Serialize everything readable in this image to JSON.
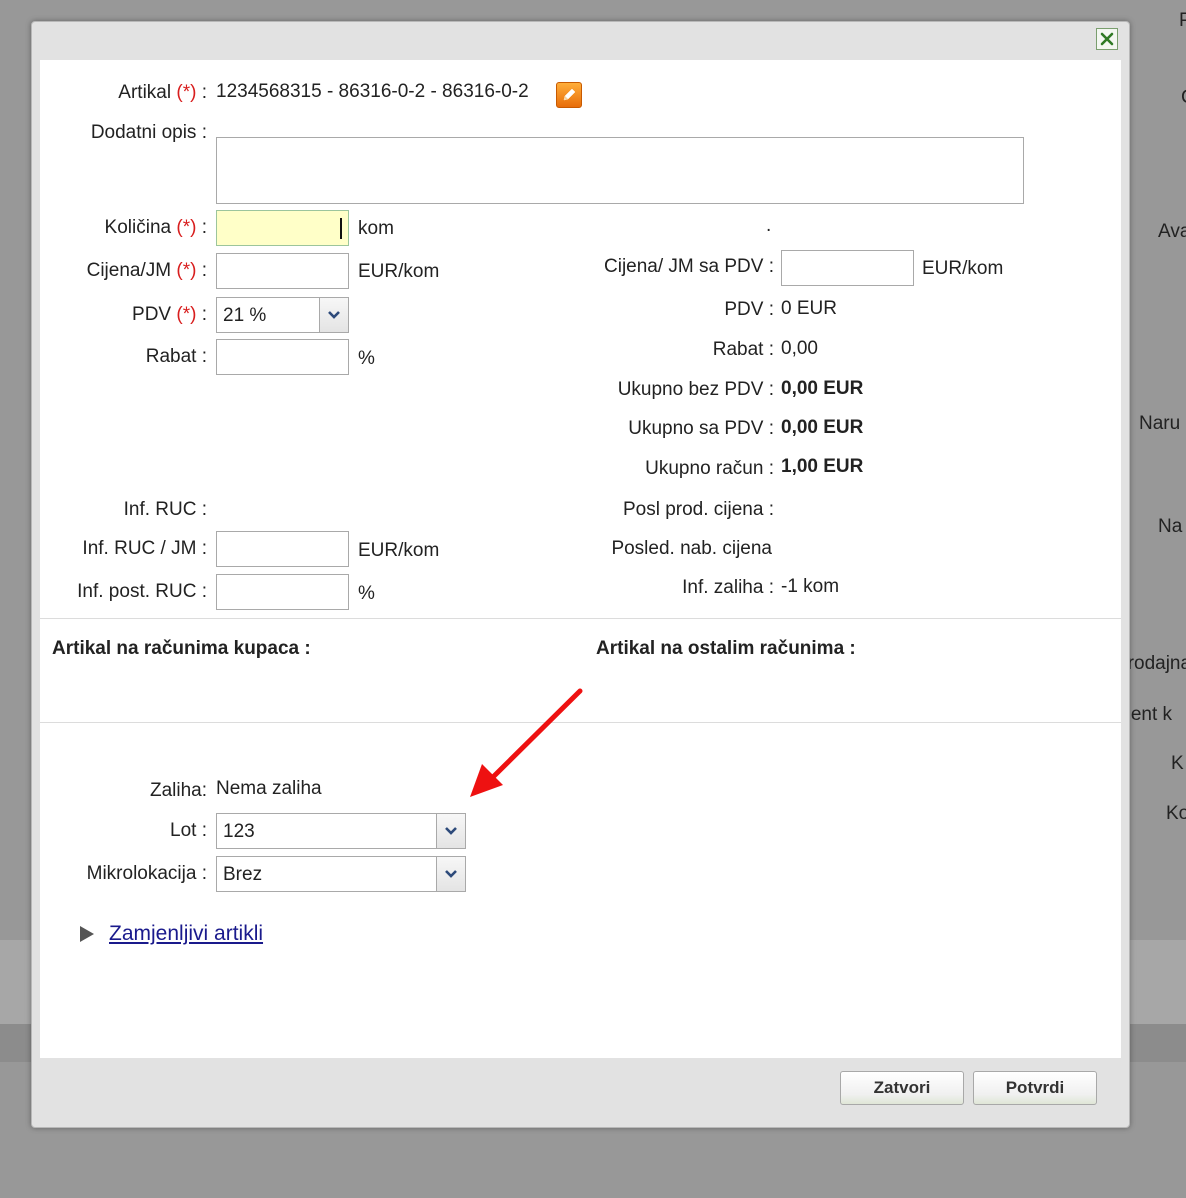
{
  "background": {
    "fragments": [
      "P",
      "C",
      "Ava",
      "Naru",
      "Na",
      "Prodajna",
      "ment k",
      "K",
      "Ko"
    ]
  },
  "dialog": {
    "article": {
      "label": "Artikal",
      "required_mark": "(*)",
      "colon": ":",
      "value": "1234568315 - 86316-0-2 - 86316-0-2"
    },
    "extra_desc": {
      "label": "Dodatni opis :",
      "value": ""
    },
    "left": {
      "quantity": {
        "label": "Količina",
        "req": "(*)",
        "colon": ":",
        "unit": "kom",
        "value": ""
      },
      "price_unit": {
        "label": "Cijena/JM",
        "req": "(*)",
        "colon": ":",
        "unit": "EUR/kom",
        "value": ""
      },
      "vat": {
        "label": "PDV",
        "req": "(*)",
        "colon": ":",
        "selected": "21 %"
      },
      "discount": {
        "label": "Rabat :",
        "unit": "%",
        "value": ""
      },
      "inf_ruc": {
        "label": "Inf. RUC :"
      },
      "inf_ruc_jm": {
        "label": "Inf. RUC / JM :",
        "unit": "EUR/kom",
        "value": ""
      },
      "inf_post_ruc": {
        "label": "Inf. post. RUC :",
        "unit": "%",
        "value": ""
      }
    },
    "right": {
      "dot": ".",
      "price_vat": {
        "label": "Cijena/ JM sa PDV :",
        "unit": "EUR/kom",
        "value": ""
      },
      "vat": {
        "label": "PDV :",
        "value": "0 EUR"
      },
      "discount": {
        "label": "Rabat :",
        "value": "0,00"
      },
      "total_no_vat": {
        "label": "Ukupno bez PDV :",
        "value": "0,00 EUR"
      },
      "total_vat": {
        "label": "Ukupno sa PDV :",
        "value": "0,00 EUR"
      },
      "total_invoice": {
        "label": "Ukupno račun :",
        "value": "1,00 EUR"
      },
      "last_sale_price": {
        "label": "Posl prod. cijena :"
      },
      "last_purchase_price": {
        "label": "Posled. nab. cijena"
      },
      "inf_stock": {
        "label": "Inf. zaliha :",
        "value": "-1 kom"
      }
    },
    "sections": {
      "customer_invoices": "Artikal na računima kupaca :",
      "other_invoices": "Artikal na ostalim računima :"
    },
    "stock": {
      "label": "Zaliha:",
      "value": "Nema zaliha",
      "lot": {
        "label": "Lot :",
        "selected": "123"
      },
      "micro": {
        "label": "Mikrolokacija :",
        "selected": "Brez"
      }
    },
    "replaceable": {
      "label": "Zamjenljivi artikli"
    },
    "buttons": {
      "close": "Zatvori",
      "confirm": "Potvrdi"
    }
  }
}
